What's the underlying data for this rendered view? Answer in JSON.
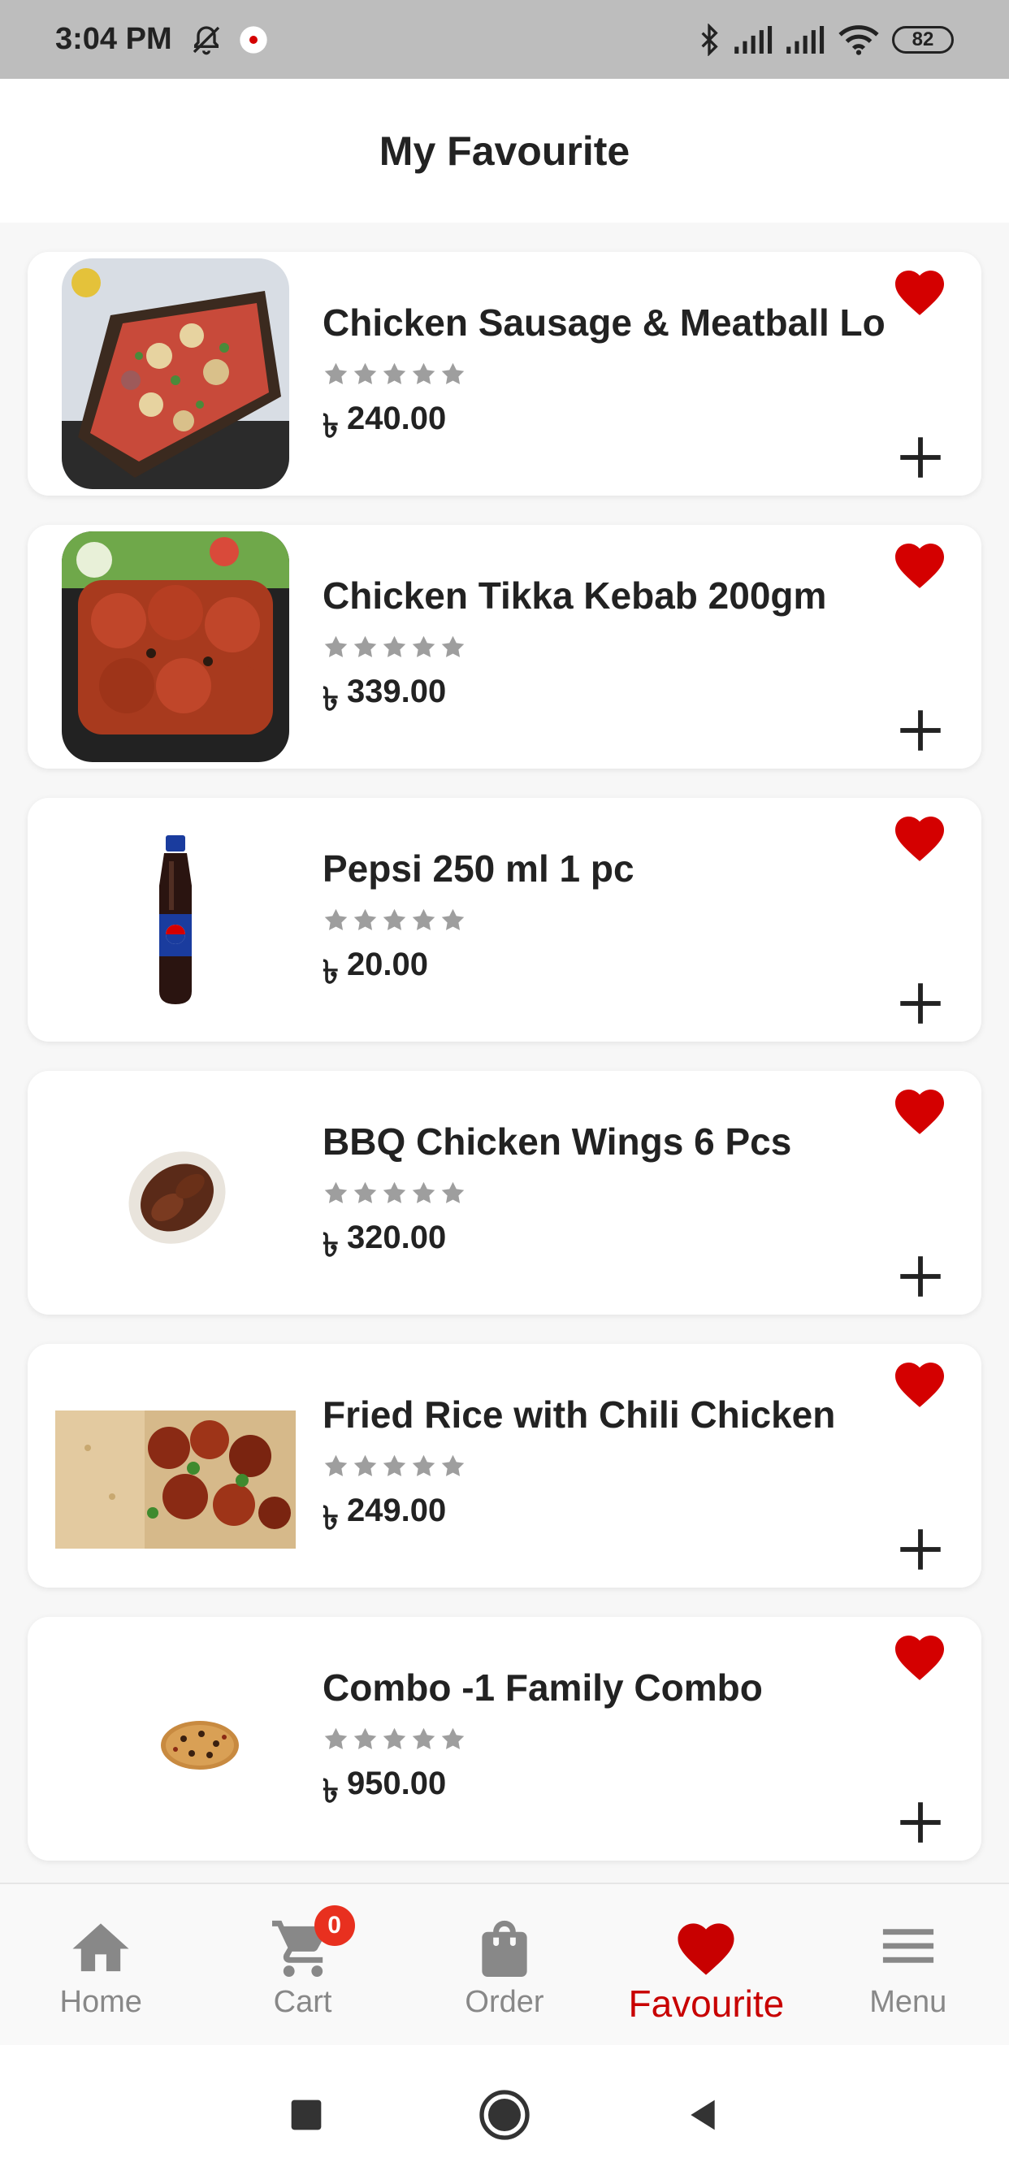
{
  "status_bar": {
    "time": "3:04 PM",
    "battery": "82",
    "icons": [
      "bell-off-icon",
      "app-notification-icon",
      "bluetooth-icon",
      "signal-icon",
      "signal-icon",
      "wifi-icon",
      "battery-icon"
    ]
  },
  "header": {
    "title": "My Favourite"
  },
  "favourites": [
    {
      "name": "Chicken Sausage & Meatball Lo",
      "currency": "৳",
      "price": "240.00",
      "image": "sausage-meatball-photo"
    },
    {
      "name": "Chicken Tikka Kebab 200gm",
      "currency": "৳",
      "price": "339.00",
      "image": "tikka-kebab-photo"
    },
    {
      "name": "Pepsi 250 ml 1 pc",
      "currency": "৳",
      "price": "20.00",
      "image": "pepsi-bottle-photo"
    },
    {
      "name": "BBQ Chicken Wings 6 Pcs",
      "currency": "৳",
      "price": "320.00",
      "image": "bbq-wings-photo"
    },
    {
      "name": "Fried Rice with Chili Chicken",
      "currency": "৳",
      "price": "249.00",
      "image": "fried-rice-photo"
    },
    {
      "name": "Combo -1 Family Combo",
      "currency": "৳",
      "price": "950.00",
      "image": "family-combo-photo"
    }
  ],
  "colors": {
    "accent": "#d40000",
    "star": "#9e9e9e",
    "badge": "#e8301f"
  },
  "bottom_nav": {
    "home": "Home",
    "cart": "Cart",
    "cart_count": "0",
    "order": "Order",
    "favourite": "Favourite",
    "menu": "Menu",
    "active": "favourite"
  }
}
